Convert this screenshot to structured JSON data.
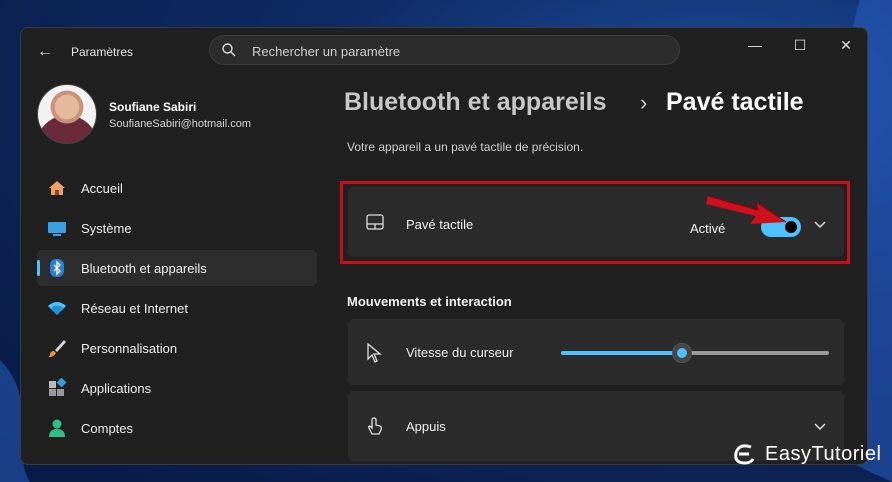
{
  "window": {
    "title": "Paramètres",
    "minimize": "—",
    "maximize": "☐",
    "close": "✕"
  },
  "search": {
    "placeholder": "Rechercher un paramètre"
  },
  "user": {
    "name": "Soufiane Sabiri",
    "email": "SoufianeSabiri@hotmail.com"
  },
  "sidebar": {
    "items": [
      {
        "label": "Accueil",
        "icon": "home-icon"
      },
      {
        "label": "Système",
        "icon": "monitor-icon"
      },
      {
        "label": "Bluetooth et appareils",
        "icon": "bluetooth-icon",
        "active": true
      },
      {
        "label": "Réseau et Internet",
        "icon": "wifi-icon"
      },
      {
        "label": "Personnalisation",
        "icon": "brush-icon"
      },
      {
        "label": "Applications",
        "icon": "apps-icon"
      },
      {
        "label": "Comptes",
        "icon": "account-icon"
      }
    ]
  },
  "breadcrumb": {
    "parent": "Bluetooth et appareils",
    "separator": "›",
    "current": "Pavé tactile"
  },
  "main": {
    "description": "Votre appareil a un pavé tactile de précision.",
    "touchpad": {
      "label": "Pavé tactile",
      "status": "Activé",
      "enabled": true
    },
    "section_title": "Mouvements et interaction",
    "cursor_speed": {
      "label": "Vitesse du curseur",
      "value_fraction": 0.45
    },
    "taps": {
      "label": "Appuis"
    }
  },
  "watermark": {
    "text": "EasyTutoriel"
  },
  "colors": {
    "accent": "#4cc2ff",
    "highlight": "#c8101b",
    "arrow": "#d0101a"
  }
}
